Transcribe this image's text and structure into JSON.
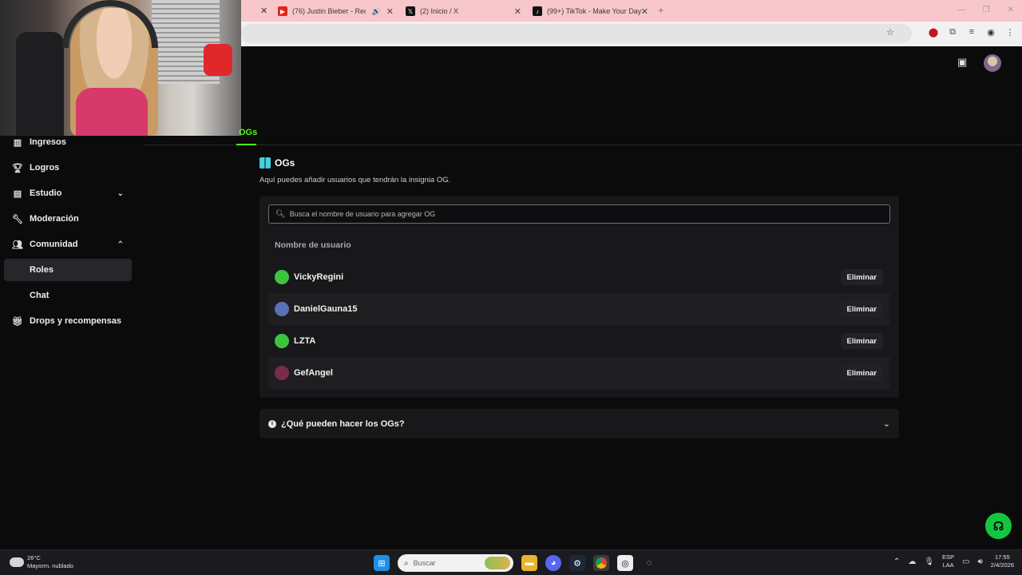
{
  "browser": {
    "tabs": [
      {
        "title": "(76) Justin Bieber - Recovery",
        "favicon": "youtube-icon",
        "audio": true
      },
      {
        "title": "(2) Inicio / X",
        "favicon": "x-icon"
      },
      {
        "title": "(99+) TikTok - Make Your Day",
        "favicon": "tiktok-icon"
      }
    ],
    "new_tab": "+"
  },
  "page_tabs": {
    "active": "OGs"
  },
  "sidebar": {
    "items": [
      {
        "label": "Ingresos",
        "icon": "chart-icon"
      },
      {
        "label": "Logros",
        "icon": "trophy-icon"
      },
      {
        "label": "Estudio",
        "icon": "studio-icon",
        "expandable": true
      },
      {
        "label": "Moderación",
        "icon": "wrench-icon"
      },
      {
        "label": "Comunidad",
        "icon": "community-icon",
        "expanded": true
      },
      {
        "label": "Roles",
        "active": true
      },
      {
        "label": "Chat"
      },
      {
        "label": "Drops y recompensas",
        "icon": "gift-icon"
      }
    ]
  },
  "og": {
    "title": "OGs",
    "description": "Aquí puedes añadir usuarios que tendrán la insignia OG.",
    "search_placeholder": "Busca el nombre de usuario para agregar OG",
    "column_header": "Nombre de usuario",
    "remove_label": "Eliminar",
    "users": [
      {
        "name": "VickyRegini",
        "avatar_color": "#3cc43f"
      },
      {
        "name": "DanielGauna15",
        "avatar_color": "#5a6fb8"
      },
      {
        "name": "LZTA",
        "avatar_color": "#3cc43f"
      },
      {
        "name": "GefAngel",
        "avatar_color": "#7a2a4a"
      }
    ],
    "faq": "¿Qué pueden hacer los OGs?"
  },
  "taskbar": {
    "weather_temp": "26°C",
    "weather_desc": "Mayorm. nublado",
    "search_placeholder": "Buscar",
    "lang_top": "ESP",
    "lang_bottom": "LAA",
    "time": "17:55",
    "date": "2/4/2026"
  },
  "colors": {
    "accent": "#53fc18",
    "card": "#18181b",
    "background": "#0b0b0c"
  }
}
